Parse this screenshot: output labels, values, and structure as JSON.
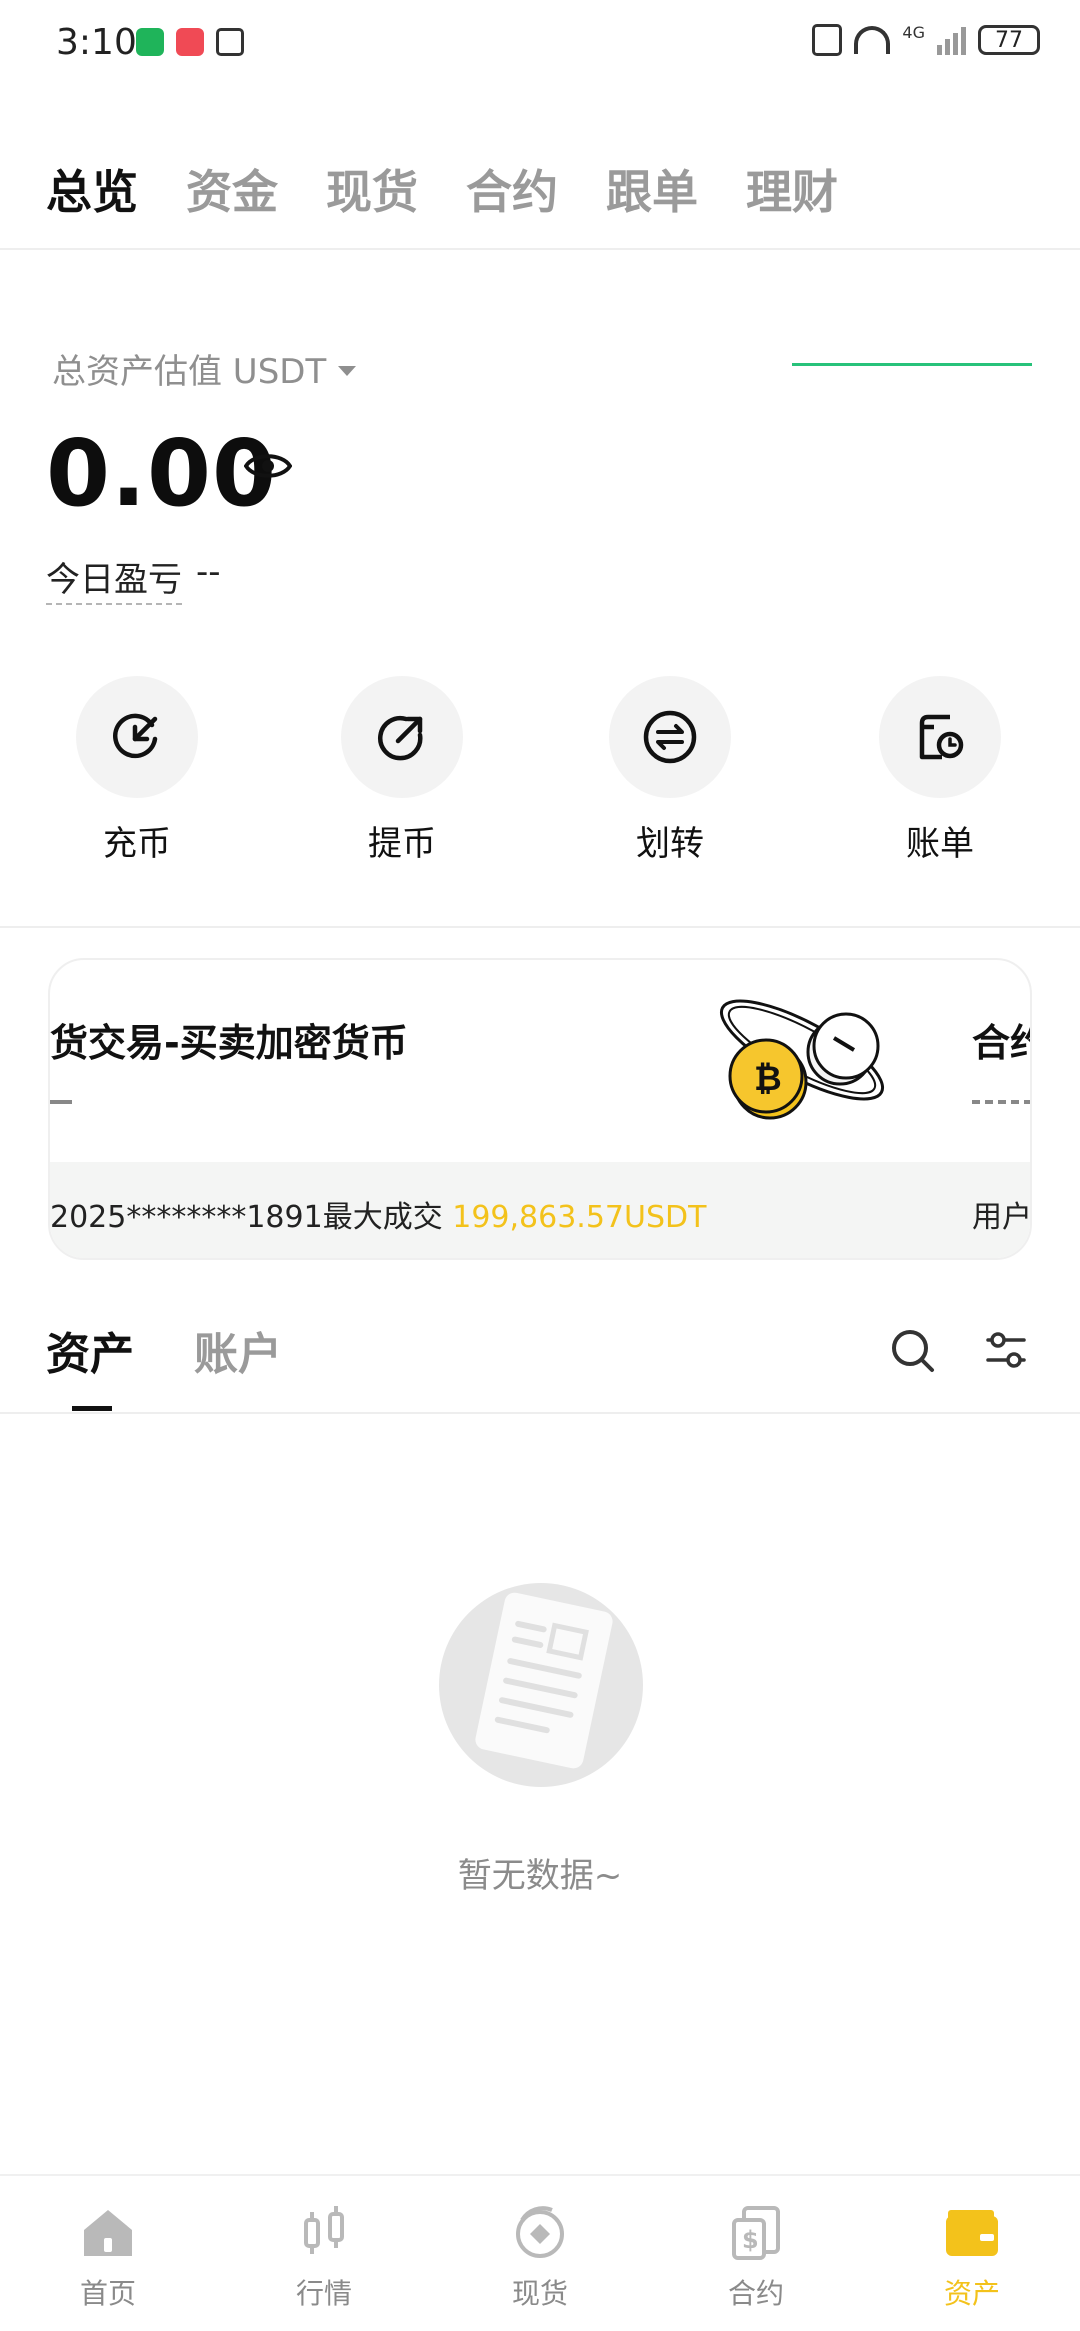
{
  "status": {
    "time": "3:10",
    "network": "4G",
    "battery": "77",
    "icons": [
      "battery-saver-icon",
      "app-notification-icon",
      "nfc-icon",
      "vibrate-icon",
      "wifi-icon",
      "signal-icon"
    ]
  },
  "top_tabs": [
    "总览",
    "资金",
    "现货",
    "合约",
    "跟单",
    "理财"
  ],
  "summary": {
    "label": "总资产估值 USDT",
    "value": "0.00",
    "pnl_label": "今日盈亏",
    "pnl_value": "--"
  },
  "actions": [
    {
      "label": "充币",
      "icon": "deposit-icon"
    },
    {
      "label": "提币",
      "icon": "withdraw-icon"
    },
    {
      "label": "划转",
      "icon": "transfer-icon"
    },
    {
      "label": "账单",
      "icon": "bill-icon"
    }
  ],
  "banner": {
    "title": "货交易-买卖加密货币",
    "right_title": "合约",
    "strip_text_prefix": "2025********1891最大成交",
    "strip_text_amount": "199,863.57USDT",
    "strip_right": "用户"
  },
  "asset_tabs": [
    "资产",
    "账户"
  ],
  "empty": {
    "text": "暂无数据~"
  },
  "bottom_nav": [
    {
      "label": "首页",
      "icon": "home-icon"
    },
    {
      "label": "行情",
      "icon": "market-icon"
    },
    {
      "label": "现货",
      "icon": "spot-icon"
    },
    {
      "label": "合约",
      "icon": "contract-icon"
    },
    {
      "label": "资产",
      "icon": "wallet-icon"
    }
  ],
  "colors": {
    "accent": "#f3c21b",
    "positive": "#27c27a",
    "muted": "#9a9a9a"
  }
}
